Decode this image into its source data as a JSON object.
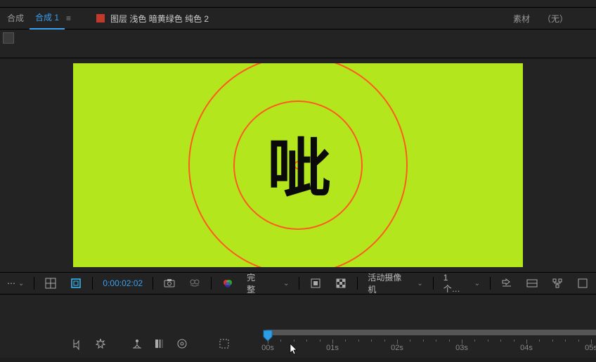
{
  "panel": {
    "tab_composition_trunc": "合成",
    "tab_composition_name": "合成 1",
    "menu_glyph": "≡",
    "layer_label_prefix": "图层",
    "layer_name": "浅色 暗黄绿色 纯色 2",
    "footage_label": "素材",
    "footage_value": "（无）"
  },
  "canvas": {
    "bg_color": "#b4e61e",
    "ring_color": "#ff5a1f",
    "outer_ring_d": 308,
    "inner_ring_d": 180,
    "text": "呲"
  },
  "viewer_bar": {
    "dropdown1": "⋯",
    "timecode": "0:00:02:02",
    "quality": "完整",
    "camera": "活动摄像机",
    "views": "1 个…"
  },
  "timeline": {
    "ticks": [
      "00s",
      "01s",
      "02s",
      "03s",
      "04s",
      "05s"
    ],
    "playhead_at_index": 0
  }
}
